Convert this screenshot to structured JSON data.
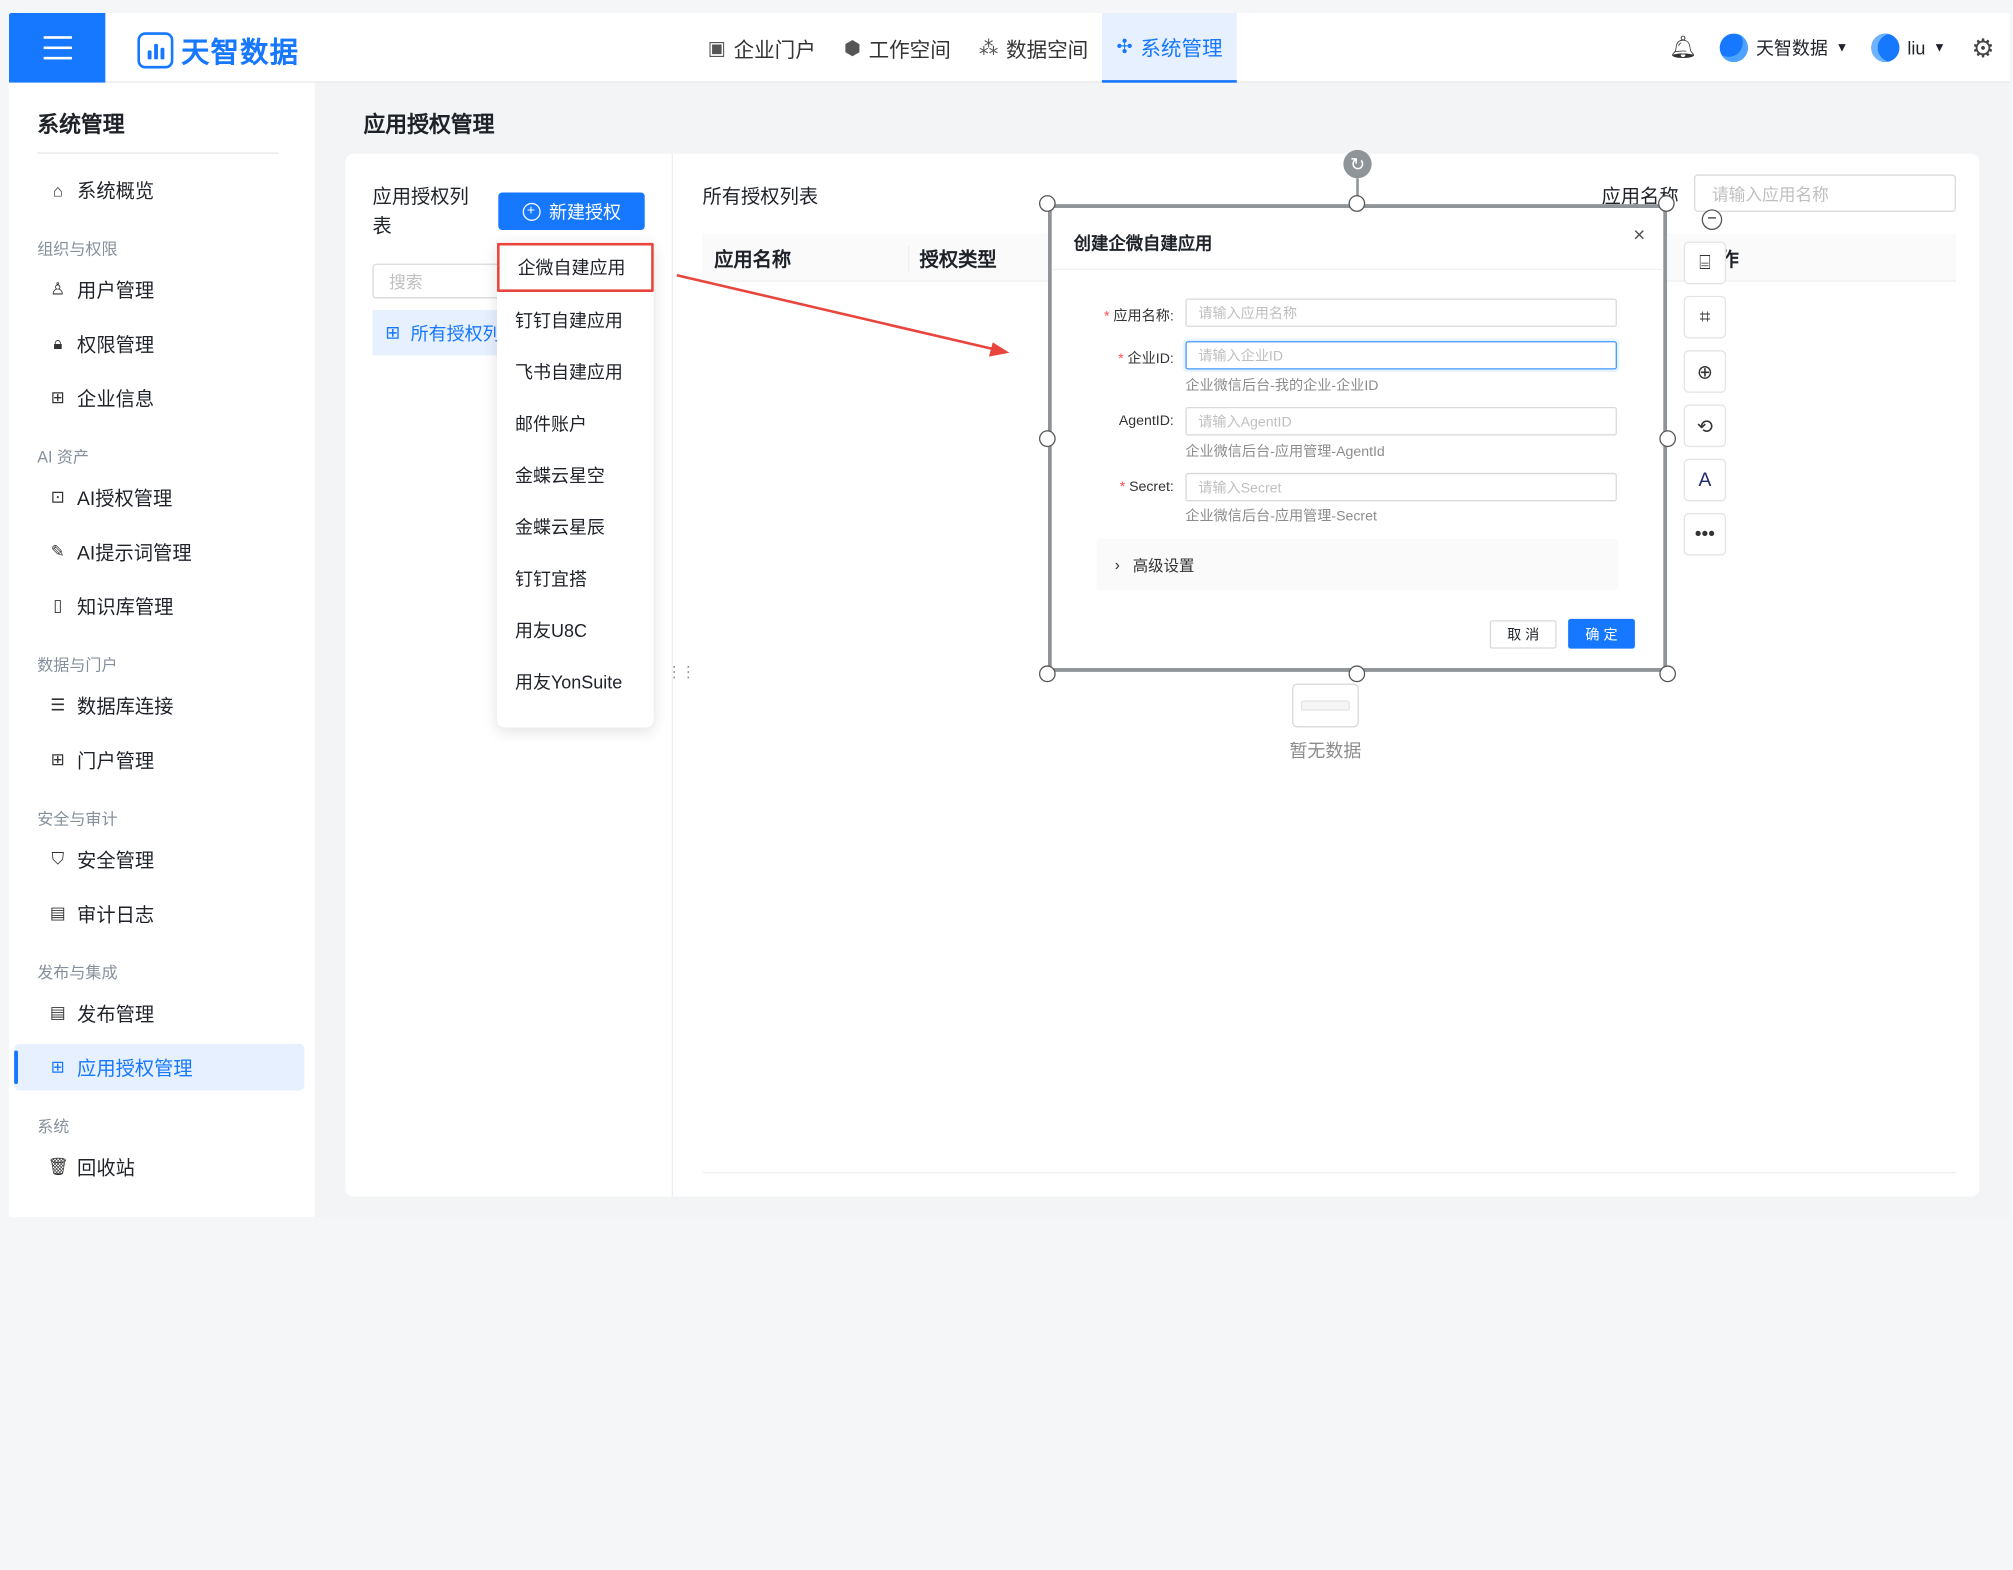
{
  "topbar": {
    "logo_text": "天智数据",
    "nav_tabs": [
      {
        "label": "企业门户",
        "icon": "chart-board-icon"
      },
      {
        "label": "工作空间",
        "icon": "cube-icon"
      },
      {
        "label": "数据空间",
        "icon": "cluster-icon"
      },
      {
        "label": "系统管理",
        "icon": "grid-icon",
        "active": true
      }
    ],
    "org_name": "天智数据",
    "user_name": "liu"
  },
  "sidebar": {
    "title": "系统管理",
    "overview": "系统概览",
    "groups": {
      "org": "组织与权限",
      "ai": "AI 资产",
      "data": "数据与门户",
      "security": "安全与审计",
      "publish": "发布与集成",
      "system": "系统"
    },
    "items": {
      "users": "用户管理",
      "permissions": "权限管理",
      "enterprise": "企业信息",
      "ai_auth": "AI授权管理",
      "ai_prompt": "AI提示词管理",
      "knowledge": "知识库管理",
      "db": "数据库连接",
      "portal": "门户管理",
      "security": "安全管理",
      "audit": "审计日志",
      "release": "发布管理",
      "app_auth": "应用授权管理",
      "recycle": "回收站"
    }
  },
  "main": {
    "page_title": "应用授权管理",
    "left_panel": {
      "title": "应用授权列表",
      "new_button": "新建授权",
      "search_placeholder": "搜索",
      "tree_item": "所有授权列表"
    },
    "right_panel": {
      "title": "所有授权列表",
      "filter_label": "应用名称",
      "filter_placeholder": "请输入应用名称",
      "columns": [
        "应用名称",
        "授权类型",
        "操作"
      ],
      "empty_text": "暂无数据"
    }
  },
  "dropdown": {
    "items": [
      "企微自建应用",
      "钉钉自建应用",
      "飞书自建应用",
      "邮件账户",
      "金蝶云星空",
      "金蝶云星辰",
      "钉钉宜搭",
      "用友U8C",
      "用友YonSuite"
    ],
    "highlighted": "企微自建应用"
  },
  "modal": {
    "title": "创建企微自建应用",
    "fields": {
      "app_name": {
        "label": "应用名称:",
        "placeholder": "请输入应用名称",
        "required": true
      },
      "corp_id": {
        "label": "企业ID:",
        "placeholder": "请输入企业ID",
        "help": "企业微信后台-我的企业-企业ID",
        "required": true
      },
      "agent_id": {
        "label": "AgentID:",
        "placeholder": "请输入AgentID",
        "help": "企业微信后台-应用管理-AgentId",
        "required": false
      },
      "secret": {
        "label": "Secret:",
        "placeholder": "请输入Secret",
        "help": "企业微信后台-应用管理-Secret",
        "required": true
      }
    },
    "advanced": "高级设置",
    "cancel": "取 消",
    "ok": "确 定"
  },
  "annotation_tools": [
    "text-edit-icon",
    "crop-icon",
    "zoom-in-icon",
    "rotate-icon",
    "ocr-icon",
    "more-icon"
  ],
  "colors": {
    "primary": "#1677ff",
    "annotation_red": "#e8453c",
    "required": "#ff4d4f"
  }
}
